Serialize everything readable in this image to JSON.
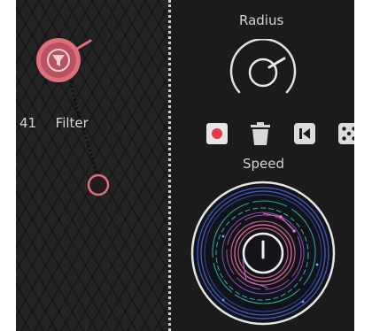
{
  "node": {
    "number": "41",
    "name": "Filter",
    "icon": "funnel-icon"
  },
  "controls": {
    "radius_label": "Radius",
    "speed_label": "Speed"
  },
  "toolbar": [
    {
      "icon": "record-icon"
    },
    {
      "icon": "trash-icon"
    },
    {
      "icon": "skip-back-icon"
    },
    {
      "icon": "dice-icon"
    }
  ],
  "colors": {
    "accent": "#e06f7c",
    "node_fill": "#b9515e",
    "orbit_blue": "#4a63c4",
    "orbit_teal": "#22a5a0",
    "orbit_pink": "#c85a8c"
  }
}
